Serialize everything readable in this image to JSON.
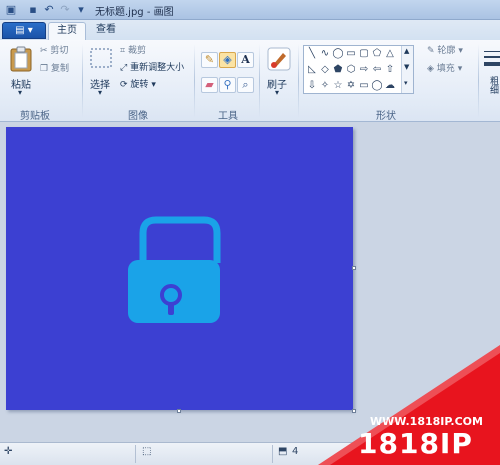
{
  "window": {
    "title": "无标题.jpg - 画图"
  },
  "tabs": {
    "file": "▤ ▾",
    "home": "主页",
    "view": "查看"
  },
  "ribbon": {
    "clipboard": {
      "paste": "粘贴",
      "cut": "剪切",
      "copy": "复制",
      "label": "剪贴板"
    },
    "image": {
      "select": "选择",
      "crop": "裁剪",
      "resize": "重新调整大小",
      "rotate": "旋转",
      "label": "图像"
    },
    "tools": {
      "label": "工具"
    },
    "brushes": {
      "label": "刷子"
    },
    "shapes": {
      "outline": "轮廓",
      "fill": "填充",
      "label": "形状"
    },
    "size": {
      "label": "粗细"
    }
  },
  "canvas": {
    "background": "#3c40d2",
    "icon_color": "#1aa3e8"
  },
  "statusbar": {
    "size_prefix": "4"
  },
  "watermark": {
    "url": "WWW.1818IP.COM",
    "brand": "1818IP"
  }
}
